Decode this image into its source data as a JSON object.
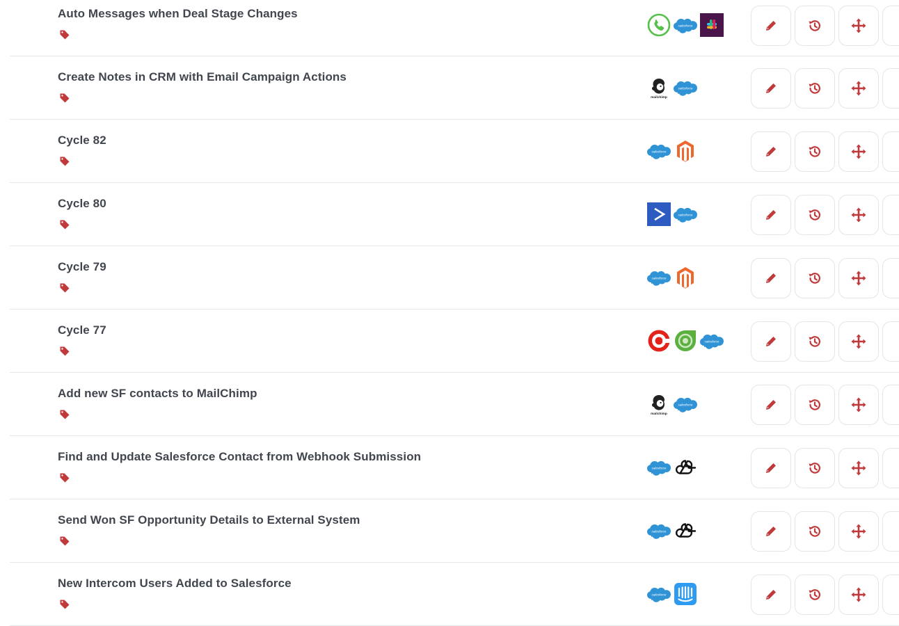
{
  "colors": {
    "accent": "#c0393b",
    "salesforce": "#2f93d6",
    "divider": "#e6e8eb"
  },
  "workflows": [
    {
      "title": "Auto Messages when Deal Stage Changes",
      "apps": [
        "phone-icon",
        "salesforce-icon",
        "slack-icon"
      ]
    },
    {
      "title": "Create Notes in CRM with Email Campaign Actions",
      "apps": [
        "mailchimp-icon",
        "salesforce-icon"
      ]
    },
    {
      "title": "Cycle 82",
      "apps": [
        "salesforce-icon",
        "magento-icon"
      ]
    },
    {
      "title": "Cycle 80",
      "apps": [
        "activecampaign-icon",
        "salesforce-icon"
      ]
    },
    {
      "title": "Cycle 79",
      "apps": [
        "salesforce-icon",
        "magento-icon"
      ]
    },
    {
      "title": "Cycle 77",
      "apps": [
        "target-icon",
        "freshdesk-icon",
        "salesforce-icon"
      ]
    },
    {
      "title": "Add new SF contacts to MailChimp",
      "apps": [
        "mailchimp-icon",
        "salesforce-icon"
      ]
    },
    {
      "title": "Find and Update Salesforce Contact from Webhook Submission",
      "apps": [
        "salesforce-icon",
        "webhook-icon"
      ]
    },
    {
      "title": "Send Won SF Opportunity Details to External System",
      "apps": [
        "salesforce-icon",
        "webhook-icon"
      ]
    },
    {
      "title": "New Intercom Users Added to Salesforce",
      "apps": [
        "salesforce-icon",
        "intercom-icon"
      ]
    }
  ],
  "actions": [
    "pencil-icon",
    "history-icon",
    "move-icon"
  ],
  "mailchimp_label": "mailchimp",
  "salesforce_label": "salesforce"
}
